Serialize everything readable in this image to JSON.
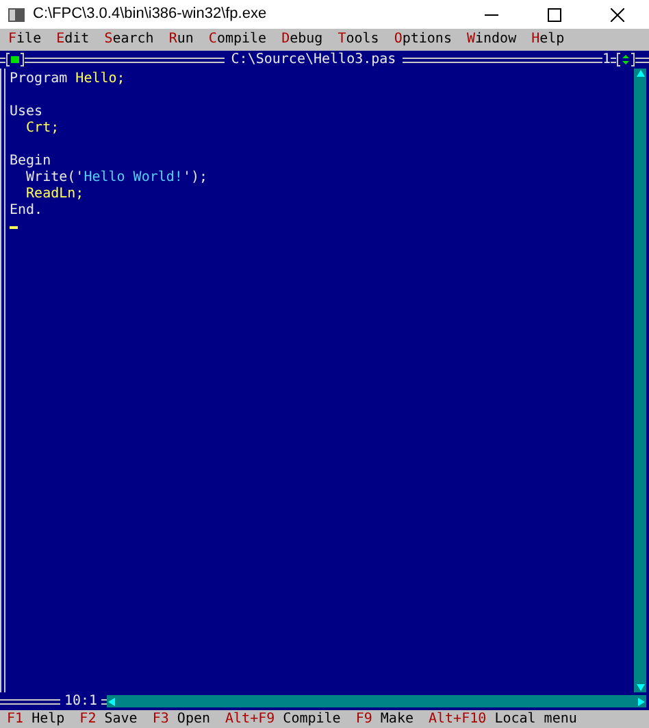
{
  "window": {
    "title": "C:\\FPC\\3.0.4\\bin\\i386-win32\\fp.exe"
  },
  "menu": [
    {
      "hotkey": "F",
      "rest": "ile"
    },
    {
      "hotkey": "E",
      "rest": "dit"
    },
    {
      "hotkey": "S",
      "rest": "earch"
    },
    {
      "hotkey": "R",
      "rest": "un"
    },
    {
      "hotkey": "C",
      "rest": "ompile"
    },
    {
      "hotkey": "D",
      "rest": "ebug"
    },
    {
      "hotkey": "T",
      "rest": "ools"
    },
    {
      "hotkey": "O",
      "rest": "ptions"
    },
    {
      "hotkey": "W",
      "rest": "indow"
    },
    {
      "hotkey": "H",
      "rest": "elp"
    }
  ],
  "editor": {
    "title": "C:\\Source\\Hello3.pas",
    "window_number": "1",
    "position": "10:1",
    "lines": [
      {
        "kind": "code",
        "tokens": [
          {
            "kind": "keyword",
            "text": "Program "
          },
          {
            "kind": "identifier",
            "text": "Hello;"
          }
        ]
      },
      {
        "kind": "blank"
      },
      {
        "kind": "code",
        "tokens": [
          {
            "kind": "keyword",
            "text": "Uses"
          }
        ]
      },
      {
        "kind": "code",
        "tokens": [
          {
            "kind": "identifier",
            "text": "  Crt;"
          }
        ]
      },
      {
        "kind": "blank"
      },
      {
        "kind": "code",
        "tokens": [
          {
            "kind": "keyword",
            "text": "Begin"
          }
        ]
      },
      {
        "kind": "code",
        "tokens": [
          {
            "kind": "keyword",
            "text": "  Write('"
          },
          {
            "kind": "string",
            "text": "Hello World!"
          },
          {
            "kind": "keyword",
            "text": "');"
          }
        ]
      },
      {
        "kind": "code",
        "tokens": [
          {
            "kind": "identifier",
            "text": "  ReadLn;"
          }
        ]
      },
      {
        "kind": "code",
        "tokens": [
          {
            "kind": "keyword",
            "text": "End."
          }
        ]
      }
    ]
  },
  "status_bar": [
    {
      "key": "F1",
      "label": "Help"
    },
    {
      "key": "F2",
      "label": "Save"
    },
    {
      "key": "F3",
      "label": "Open"
    },
    {
      "key": "Alt+F9",
      "label": "Compile"
    },
    {
      "key": "F9",
      "label": "Make"
    },
    {
      "key": "Alt+F10",
      "label": "Local menu"
    }
  ]
}
